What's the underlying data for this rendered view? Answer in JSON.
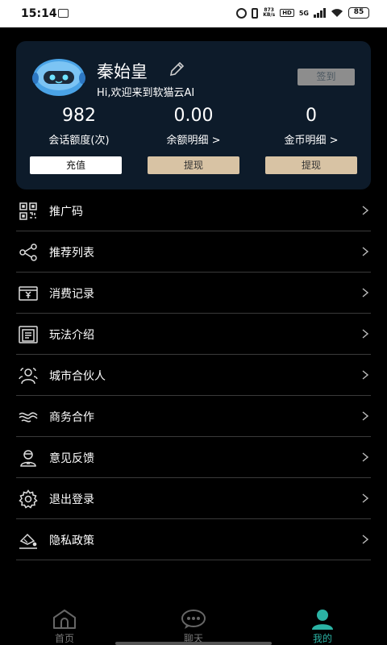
{
  "status_bar": {
    "time": "15:14",
    "net_speed": "873",
    "net_speed_unit": "KB/s",
    "hd": "HD",
    "signal": "5G",
    "battery": "85"
  },
  "profile": {
    "name": "秦始皇",
    "greeting": "Hi,欢迎来到软猫云AI",
    "checkin_label": "签到",
    "stats": [
      {
        "value": "982",
        "label": "会话额度(次)"
      },
      {
        "value": "0.00",
        "label": "余额明细 >"
      },
      {
        "value": "0",
        "label": "金币明细 >"
      }
    ],
    "recharge_label": "充值",
    "withdraw_label_1": "提现",
    "withdraw_label_2": "提现"
  },
  "menu": [
    {
      "label": "推广码",
      "icon": "qr-code-icon"
    },
    {
      "label": "推荐列表",
      "icon": "share-icon"
    },
    {
      "label": "消费记录",
      "icon": "yuan-wallet-icon"
    },
    {
      "label": "玩法介绍",
      "icon": "document-icon"
    },
    {
      "label": "城市合伙人",
      "icon": "partners-icon"
    },
    {
      "label": "商务合作",
      "icon": "handshake-icon"
    },
    {
      "label": "意见反馈",
      "icon": "feedback-icon"
    },
    {
      "label": "退出登录",
      "icon": "gear-icon"
    },
    {
      "label": "隐私政策",
      "icon": "privacy-icon"
    }
  ],
  "bottom_nav": [
    {
      "label": "首页",
      "icon": "home-icon"
    },
    {
      "label": "聊天",
      "icon": "chat-icon"
    },
    {
      "label": "我的",
      "icon": "user-icon",
      "active": true
    }
  ],
  "colors": {
    "card_bg": "#0d1b2a",
    "accent": "#2bb3a4",
    "withdraw_btn": "#d8c3a4"
  }
}
